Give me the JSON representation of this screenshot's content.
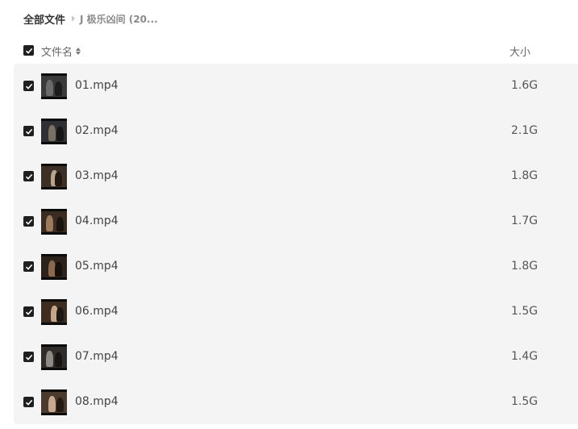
{
  "breadcrumb": {
    "root": "全部文件",
    "current": "J 极乐凶间 (20..."
  },
  "header": {
    "name_label": "文件名",
    "size_label": "大小",
    "select_all_checked": true
  },
  "files": [
    {
      "name": "01.mp4",
      "size": "1.6G",
      "checked": true
    },
    {
      "name": "02.mp4",
      "size": "2.1G",
      "checked": true
    },
    {
      "name": "03.mp4",
      "size": "1.8G",
      "checked": true
    },
    {
      "name": "04.mp4",
      "size": "1.7G",
      "checked": true
    },
    {
      "name": "05.mp4",
      "size": "1.8G",
      "checked": true
    },
    {
      "name": "06.mp4",
      "size": "1.5G",
      "checked": true
    },
    {
      "name": "07.mp4",
      "size": "1.4G",
      "checked": true
    },
    {
      "name": "08.mp4",
      "size": "1.5G",
      "checked": true
    }
  ],
  "icons": {
    "checkbox": "checkmark-icon",
    "sort": "sort-icon",
    "separator": "chevron-right-icon",
    "thumbnail": "video-thumbnail"
  },
  "colors": {
    "list_background": "#f4f4f4",
    "checkbox_fill": "#1f1f1f"
  }
}
